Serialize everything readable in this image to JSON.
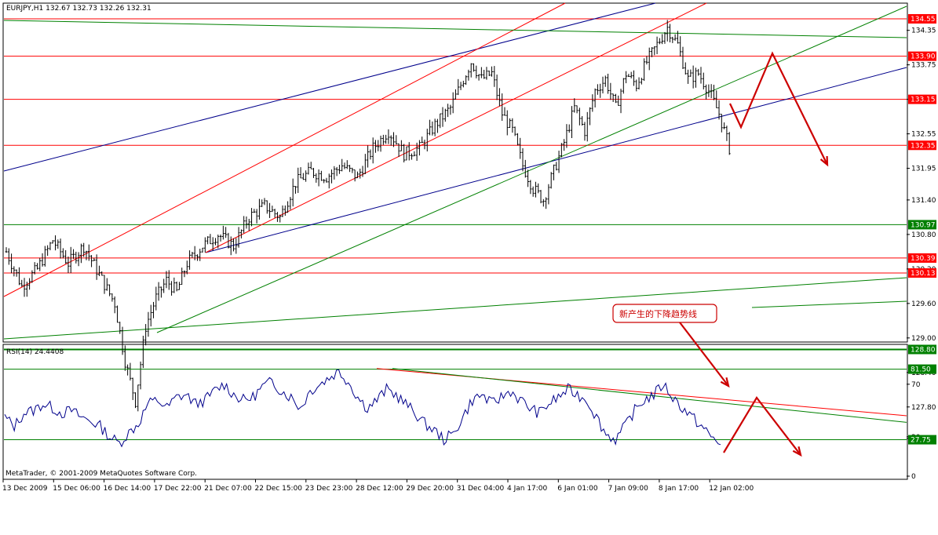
{
  "main_title": "EURJPY,H1  132.67 132.73 132.26 132.31",
  "rsi_title": "RSI(14) 24.4408",
  "copyright": "MetaTrader, © 2001-2009 MetaQuotes Software Corp.",
  "annotation": "新产生的下降趋势线",
  "colors": {
    "candle": "#000000",
    "rsi_line": "#00008b",
    "red": "#ff0000",
    "blue": "#00008b",
    "green": "#008000",
    "arrow": "#cc0000",
    "tag_red": "#ff0000",
    "tag_green": "#008000"
  },
  "chart_data": {
    "type": "candlestick",
    "symbol": "EURJPY",
    "timeframe": "H1",
    "y_axis_ticks": [
      "134.35",
      "133.75",
      "133.15",
      "132.55",
      "131.95",
      "131.40",
      "130.80",
      "130.20",
      "129.60",
      "129.00",
      "128.40",
      "127.80",
      "127.25"
    ],
    "x_axis_ticks": [
      "13 Dec 2009",
      "15 Dec 06:00",
      "16 Dec 14:00",
      "17 Dec 22:00",
      "21 Dec 07:00",
      "22 Dec 15:00",
      "23 Dec 23:00",
      "28 Dec 12:00",
      "29 Dec 20:00",
      "31 Dec 04:00",
      "4 Jan 17:00",
      "6 Jan 01:00",
      "7 Jan 09:00",
      "8 Jan 17:00",
      "12 Jan 02:00"
    ],
    "price_levels": [
      {
        "label": "134.55",
        "value": 134.55,
        "color": "red"
      },
      {
        "label": "133.90",
        "value": 133.9,
        "color": "red"
      },
      {
        "label": "133.15",
        "value": 133.15,
        "color": "red"
      },
      {
        "label": "132.35",
        "value": 132.35,
        "color": "red"
      },
      {
        "label": "130.97",
        "value": 130.97,
        "color": "green"
      },
      {
        "label": "130.39",
        "value": 130.39,
        "color": "red"
      },
      {
        "label": "130.13",
        "value": 130.13,
        "color": "red"
      },
      {
        "label": "128.80",
        "value": 128.8,
        "color": "green"
      }
    ],
    "close_path": [
      [
        0,
        130.5
      ],
      [
        6,
        129.9
      ],
      [
        12,
        130.2
      ],
      [
        18,
        130.7
      ],
      [
        24,
        130.3
      ],
      [
        30,
        130.6
      ],
      [
        36,
        130.1
      ],
      [
        42,
        129.6
      ],
      [
        46,
        128.6
      ],
      [
        50,
        127.9
      ],
      [
        54,
        129.2
      ],
      [
        58,
        129.7
      ],
      [
        62,
        130.0
      ],
      [
        66,
        129.8
      ],
      [
        70,
        130.3
      ],
      [
        76,
        130.6
      ],
      [
        82,
        130.8
      ],
      [
        88,
        130.6
      ],
      [
        94,
        131.1
      ],
      [
        100,
        131.3
      ],
      [
        106,
        131.1
      ],
      [
        112,
        131.7
      ],
      [
        118,
        131.9
      ],
      [
        124,
        131.8
      ],
      [
        130,
        132.0
      ],
      [
        136,
        131.8
      ],
      [
        142,
        132.3
      ],
      [
        148,
        132.6
      ],
      [
        154,
        132.2
      ],
      [
        160,
        132.3
      ],
      [
        166,
        132.7
      ],
      [
        172,
        133.0
      ],
      [
        176,
        133.4
      ],
      [
        180,
        133.8
      ],
      [
        184,
        133.5
      ],
      [
        188,
        133.6
      ],
      [
        192,
        132.9
      ],
      [
        196,
        132.6
      ],
      [
        200,
        132.0
      ],
      [
        204,
        131.6
      ],
      [
        208,
        131.4
      ],
      [
        212,
        131.9
      ],
      [
        216,
        132.4
      ],
      [
        220,
        133.0
      ],
      [
        224,
        132.6
      ],
      [
        228,
        133.3
      ],
      [
        232,
        133.5
      ],
      [
        236,
        133.0
      ],
      [
        240,
        133.6
      ],
      [
        244,
        133.4
      ],
      [
        248,
        133.8
      ],
      [
        252,
        134.1
      ],
      [
        256,
        134.4
      ],
      [
        260,
        134.1
      ],
      [
        264,
        133.5
      ],
      [
        268,
        133.6
      ],
      [
        272,
        133.3
      ],
      [
        276,
        132.9
      ],
      [
        280,
        132.3
      ]
    ],
    "rsi": {
      "period": 14,
      "current": 24.4408,
      "levels": [
        {
          "label": "81.50",
          "value": 81.5
        },
        {
          "label": "27.75",
          "value": 27.75
        }
      ],
      "scale_ticks": [
        "70",
        "30",
        "0"
      ],
      "values": [
        45,
        38,
        48,
        50,
        55,
        52,
        48,
        50,
        45,
        42,
        38,
        30,
        25,
        33,
        40,
        55,
        58,
        52,
        60,
        62,
        55,
        58,
        65,
        70,
        62,
        58,
        60,
        68,
        72,
        65,
        60,
        52,
        65,
        70,
        75,
        80,
        72,
        60,
        52,
        58,
        66,
        62,
        55,
        48,
        40,
        35,
        28,
        32,
        45,
        58,
        62,
        55,
        60,
        65,
        58,
        52,
        48,
        55,
        60,
        66,
        62,
        58,
        45,
        32,
        28,
        38,
        50,
        58,
        62,
        70,
        60,
        52,
        45,
        38,
        30,
        24
      ]
    }
  }
}
